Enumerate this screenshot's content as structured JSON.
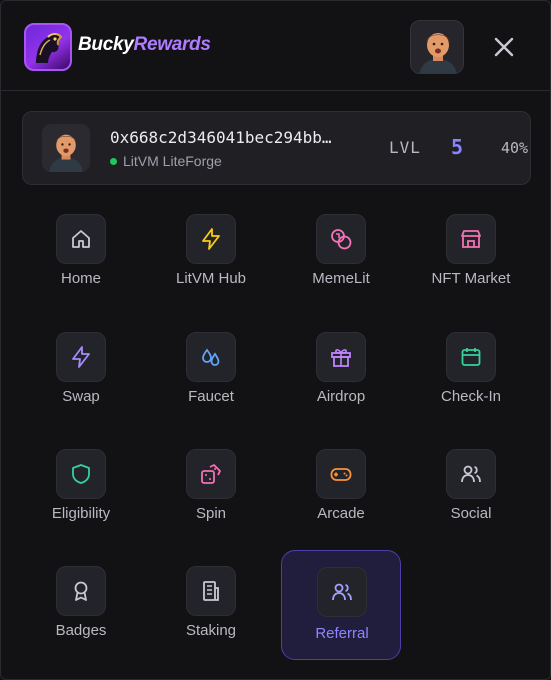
{
  "header": {
    "brand_part1": "Bucky",
    "brand_part2": "Rewards"
  },
  "wallet": {
    "address": "0x668c2d346041bec294bb…",
    "network": "LitVM LiteForge",
    "level_label": "LVL",
    "level_value": "5",
    "progress": "40%"
  },
  "menu": [
    {
      "label": "Home",
      "icon": "home-icon",
      "color": "#c9c9d1"
    },
    {
      "label": "LitVM Hub",
      "icon": "lightning-icon",
      "color": "#facc15"
    },
    {
      "label": "MemeLit",
      "icon": "coins-icon",
      "color": "#f472b6"
    },
    {
      "label": "NFT Market",
      "icon": "storefront-icon",
      "color": "#f472b6"
    },
    {
      "label": "Swap",
      "icon": "lightning-icon",
      "color": "#a78bfa"
    },
    {
      "label": "Faucet",
      "icon": "droplets-icon",
      "color": "#60a5fa"
    },
    {
      "label": "Airdrop",
      "icon": "gift-icon",
      "color": "#c084fc"
    },
    {
      "label": "Check-In",
      "icon": "calendar-icon",
      "color": "#34d399"
    },
    {
      "label": "Eligibility",
      "icon": "shield-icon",
      "color": "#34d399"
    },
    {
      "label": "Spin",
      "icon": "dice-icon",
      "color": "#f472b6"
    },
    {
      "label": "Arcade",
      "icon": "gamepad-icon",
      "color": "#fb923c"
    },
    {
      "label": "Social",
      "icon": "users-icon",
      "color": "#c9c9d1"
    },
    {
      "label": "Badges",
      "icon": "award-icon",
      "color": "#c9c9d1"
    },
    {
      "label": "Staking",
      "icon": "building-icon",
      "color": "#c9c9d1"
    },
    {
      "label": "Referral",
      "icon": "users-icon",
      "color": "#a5a0ff",
      "active": true
    }
  ]
}
